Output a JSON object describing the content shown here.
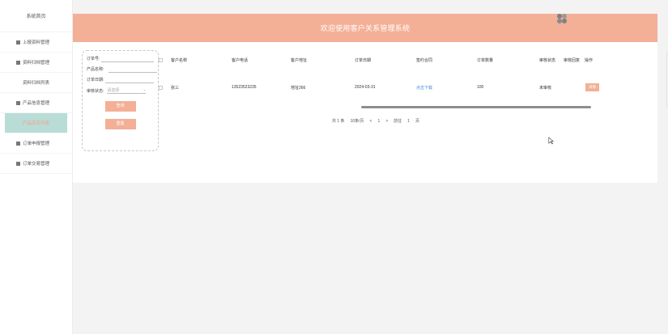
{
  "sidebar": {
    "home": "系统首页",
    "items": [
      {
        "label": "上报资料管理",
        "icon": "menu-icon"
      },
      {
        "label": "资料归档管理",
        "icon": "menu-icon"
      },
      {
        "label": "资料归档列表",
        "icon": ""
      },
      {
        "label": "产品信息管理",
        "icon": "menu-icon"
      },
      {
        "label": "产品库存列表",
        "icon": ""
      },
      {
        "label": "订单申报管理",
        "icon": "menu-icon"
      },
      {
        "label": "订单交易管理",
        "icon": "menu-icon"
      }
    ]
  },
  "header": {
    "title": "欢迎使用客户关系管理系统"
  },
  "filters": {
    "order_no_label": "订单号:",
    "product_name_label": "产品名称:",
    "order_date_label": "订单日期:",
    "status_label": "审核状态:",
    "status_placeholder": "请选择",
    "search_button": "查询",
    "reset_button": "重置"
  },
  "table": {
    "columns": [
      "客户名称",
      "客户电话",
      "客户地址",
      "订单日期",
      "签约合同",
      "订单数量",
      "审核状态",
      "审核回复",
      "操作"
    ],
    "rows": [
      {
        "name": "张三",
        "phone": "13523523235",
        "address": "地址266",
        "date": "2024-03-31",
        "contract": "点击下载",
        "qty": "100",
        "status": "未审核",
        "reply": "",
        "action": "详情"
      }
    ]
  },
  "pagination": {
    "total": "共 1 条",
    "page_size": "10条/页",
    "prev": "<",
    "current": "1",
    "next": ">",
    "goto_label": "前往",
    "goto_value": "1",
    "page_unit": "页"
  },
  "colors": {
    "accent": "#f3b096",
    "active_menu_bg": "#b9dcd6",
    "link": "#4a86d9"
  }
}
